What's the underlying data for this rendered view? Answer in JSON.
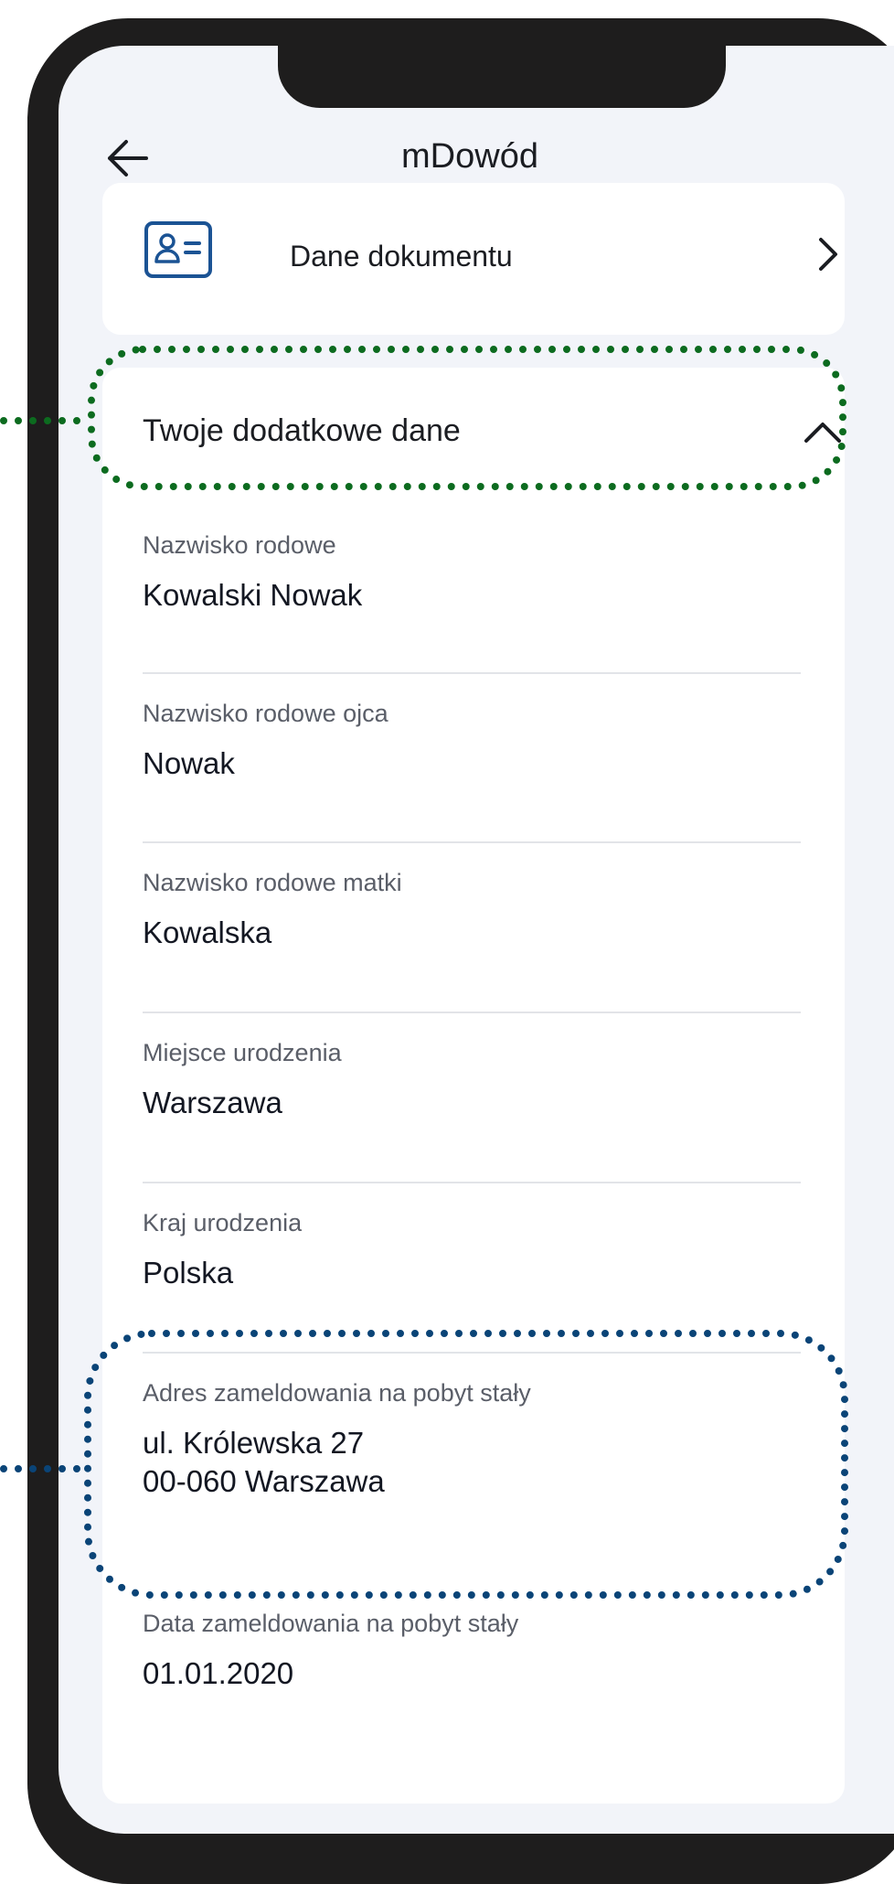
{
  "header": {
    "title": "mDowód",
    "back_icon": "arrow-left-icon"
  },
  "document_card": {
    "label": "Dane dokumentu",
    "icon": "id-card-icon",
    "chevron_icon": "chevron-right-icon"
  },
  "extra_section": {
    "title": "Twoje dodatkowe dane",
    "chevron_icon": "chevron-up-icon",
    "fields": [
      {
        "label": "Nazwisko rodowe",
        "value": "Kowalski Nowak"
      },
      {
        "label": "Nazwisko rodowe ojca",
        "value": "Nowak"
      },
      {
        "label": "Nazwisko rodowe matki",
        "value": "Kowalska"
      },
      {
        "label": "Miejsce urodzenia",
        "value": "Warszawa"
      },
      {
        "label": "Kraj urodzenia",
        "value": "Polska"
      },
      {
        "label": "Adres zameldowania na pobyt stały",
        "value": "ul. Królewska 27\n00-060 Warszawa"
      },
      {
        "label": "Data zameldowania na pobyt stały",
        "value": "01.01.2020"
      }
    ]
  },
  "colors": {
    "frame": "#1e1d1d",
    "screen_bg": "#f2f4f9",
    "card_bg": "#ffffff",
    "icon_blue": "#1b5394",
    "callout_green": "#0c6b1f",
    "callout_blue": "#0a4477"
  }
}
